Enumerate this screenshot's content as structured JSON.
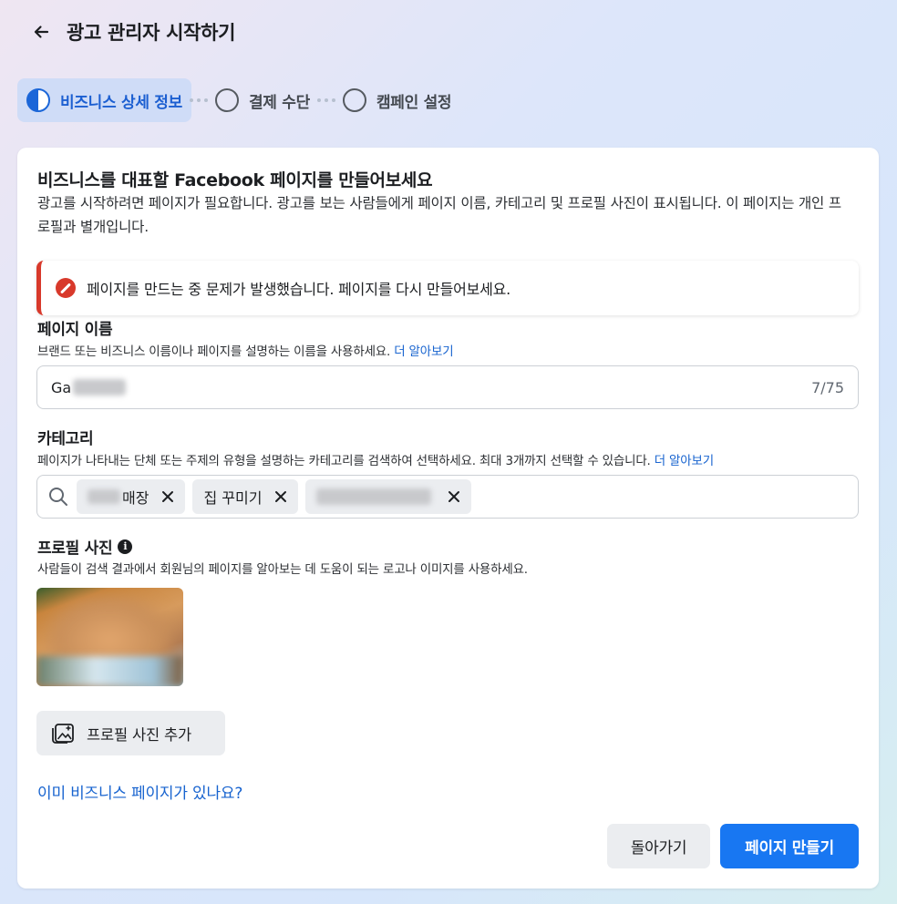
{
  "header": {
    "title": "광고 관리자 시작하기"
  },
  "steps": [
    {
      "label": "비즈니스 상세 정보",
      "state": "in-progress"
    },
    {
      "label": "결제 수단",
      "state": "pending"
    },
    {
      "label": "캠페인 설정",
      "state": "pending"
    }
  ],
  "card": {
    "heading": "비즈니스를 대표할 Facebook 페이지를 만들어보세요",
    "description": "광고를 시작하려면 페이지가 필요합니다. 광고를 보는 사람들에게 페이지 이름, 카테고리 및 프로필 사진이 표시됩니다. 이 페이지는 개인 프로필과 별개입니다."
  },
  "alert": {
    "message": "페이지를 만드는 중 문제가 발생했습니다. 페이지를 다시 만들어보세요.",
    "color": "#d8392b"
  },
  "page_name": {
    "label": "페이지 이름",
    "help": "브랜드 또는 비즈니스 이름이나 페이지를 설명하는 이름을 사용하세요.",
    "learn_more": "더 알아보기",
    "value_visible": "Ga",
    "counter": "7/75"
  },
  "category": {
    "label": "카테고리",
    "help": "페이지가 나타내는 단체 또는 주제의 유형을 설명하는 카테고리를 검색하여 선택하세요. 최대 3개까지 선택할 수 있습니다.",
    "learn_more": "더 알아보기",
    "chips": [
      {
        "label": "매장"
      },
      {
        "label": "집 꾸미기"
      },
      {
        "label": ""
      }
    ]
  },
  "profile_photo": {
    "label": "프로필 사진",
    "help": "사람들이 검색 결과에서 회원님의 페이지를 알아보는 데 도움이 되는 로고나 이미지를 사용하세요.",
    "add_button": "프로필 사진 추가"
  },
  "existing_page_link": "이미 비즈니스 페이지가 있나요?",
  "footer": {
    "back_button": "돌아가기",
    "create_button": "페이지 만들기"
  },
  "colors": {
    "primary": "#1877f2",
    "link": "#1763cf",
    "active_step": "#1c5fd1",
    "error": "#d8392b"
  }
}
